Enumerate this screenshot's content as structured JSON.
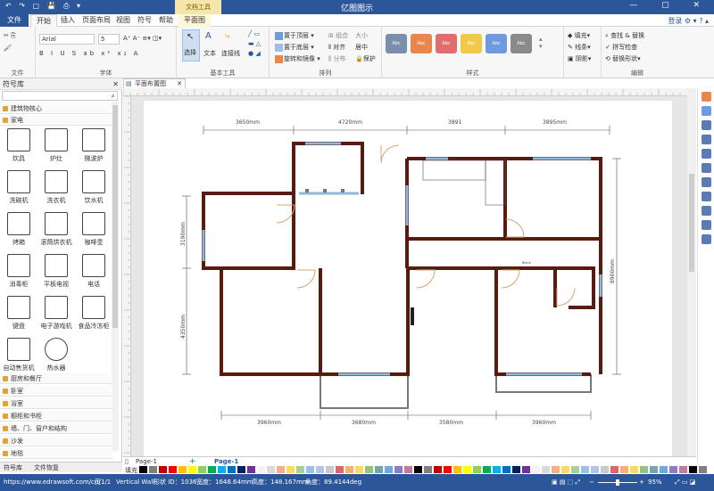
{
  "window": {
    "title": "亿图图示",
    "context_tab_group": "文档工具"
  },
  "quick_access": "↶ ↷ ▢ 💾 ⎙ ▾",
  "window_controls": "— ▢ ✕",
  "menu": {
    "file": "文件",
    "tabs": [
      "开始",
      "插入",
      "页面布局",
      "视图",
      "符号",
      "帮助",
      "平面图"
    ],
    "login": "登录"
  },
  "ribbon": {
    "groups": [
      "文件",
      "字体",
      "基本工具",
      "排列",
      "样式",
      "编辑"
    ],
    "font": {
      "name": "Arial",
      "size": "5",
      "buttons": "B I U S ab x² x₂ A"
    },
    "tools": {
      "select": "选择",
      "text": "文本",
      "connector": "连接线"
    },
    "arrange": {
      "bring_front": "置于顶层",
      "send_back": "置于底层",
      "rotate_mirror": "旋转和镜像",
      "group": "组合",
      "align": "对齐",
      "distribute": "分布",
      "size": "大小",
      "center": "居中",
      "protect": "保护"
    },
    "style_label": "Abc",
    "style_colors": [
      "#5b7bb5",
      "#e8874d",
      "#e06e6e",
      "#f0c84a",
      "#6e9be0",
      "#8a8a8a"
    ],
    "fill": "填充",
    "line": "线条",
    "shadow": "阴影",
    "edit": {
      "find_replace": "查找 & 替换",
      "spell": "拼写检查",
      "change_shape": "替换形状"
    }
  },
  "left_panel": {
    "title": "符号库",
    "categories_top": [
      "建筑物核心",
      "家电"
    ],
    "symbols": [
      "炊具",
      "炉灶",
      "微波炉",
      "洗碗机",
      "洗衣机",
      "饮水机",
      "烤箱",
      "滚筒烘衣机",
      "咖啡壶",
      "消毒柜",
      "平板电视",
      "电话",
      "键盘",
      "电子游戏机",
      "食品冷冻柜",
      "自动售货机",
      "热水器"
    ],
    "categories_bottom": [
      "厨房和餐厅",
      "卧室",
      "浴室",
      "橱柜和书柜",
      "墙、门、窗户和结构",
      "沙发",
      "地毯"
    ],
    "tabs": [
      "符号库",
      "文件恢复"
    ]
  },
  "document_tab": "平面布置图",
  "canvas": {
    "dims_top": [
      "3650mm",
      "4720mm",
      "3891",
      "3895mm"
    ],
    "dims_bottom": [
      "3960mm",
      "3680mm",
      "3580mm",
      "3960mm"
    ],
    "dims_left": [
      "3190mm",
      "4350mm"
    ],
    "dims_right": [
      "8900mm"
    ],
    "small_label": "Blank"
  },
  "pages": {
    "current": "Page-1",
    "tabs": [
      "Page-1"
    ]
  },
  "palette_label": "填充",
  "palette": [
    "#000000",
    "#7f7f7f",
    "#c00000",
    "#ff0000",
    "#ffc000",
    "#ffff00",
    "#92d050",
    "#00b050",
    "#00b0f0",
    "#0070c0",
    "#002060",
    "#7030a0",
    "#f2f2f2",
    "#d9d9d9",
    "#f4b084",
    "#ffd966",
    "#a9d08e",
    "#9bc2e6",
    "#b4c6e7",
    "#c9c9c9",
    "#e06666",
    "#f6b26b",
    "#ffd966",
    "#93c47d",
    "#76a5af",
    "#6fa8dc",
    "#8e7cc3",
    "#c27ba0"
  ],
  "status": {
    "url": "https://www.edrawsoft.com/cn/",
    "page": "页1/1",
    "shape_name": "Vertical Wall",
    "shape_id": "形状 ID：1036",
    "width": "宽度：1648.64mm",
    "height": "高度：148.167mm",
    "angle": "角度：89.4144deg",
    "zoom": "95%"
  }
}
